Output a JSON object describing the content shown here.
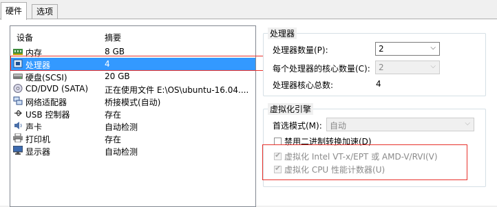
{
  "tabs": [
    {
      "label": "硬件",
      "active": true
    },
    {
      "label": "选项",
      "active": false
    }
  ],
  "device_list": {
    "headers": {
      "device": "设备",
      "summary": "摘要"
    },
    "rows": [
      {
        "icon": "memory-icon",
        "name": "内存",
        "value": "8 GB",
        "selected": false
      },
      {
        "icon": "processor-icon",
        "name": "处理器",
        "value": "4",
        "selected": true
      },
      {
        "icon": "hard-disk-icon",
        "name": "硬盘(SCSI)",
        "value": "20 GB",
        "selected": false
      },
      {
        "icon": "cd-dvd-icon",
        "name": "CD/DVD (SATA)",
        "value": "正在使用文件 E:\\OS\\ubuntu-16.04....",
        "selected": false
      },
      {
        "icon": "network-adapter-icon",
        "name": "网络适配器",
        "value": "桥接模式(自动)",
        "selected": false
      },
      {
        "icon": "usb-controller-icon",
        "name": "USB 控制器",
        "value": "存在",
        "selected": false
      },
      {
        "icon": "sound-card-icon",
        "name": "声卡",
        "value": "自动检测",
        "selected": false
      },
      {
        "icon": "printer-icon",
        "name": "打印机",
        "value": "存在",
        "selected": false
      },
      {
        "icon": "display-icon",
        "name": "显示器",
        "value": "自动检测",
        "selected": false
      }
    ]
  },
  "processor_group": {
    "title": "处理器",
    "count_label": "处理器数量(P):",
    "count_value": "2",
    "cores_label": "每个处理器的核心数量(C):",
    "cores_value": "2",
    "total_label": "处理器核心总数:",
    "total_value": "4"
  },
  "virt_group": {
    "title": "虚拟化引擎",
    "mode_label": "首选模式(M):",
    "mode_value": "自动",
    "disable_binary": {
      "label": "禁用二进制转换加速(D)",
      "checked": false
    },
    "vtx": {
      "label": "虚拟化 Intel VT-x/EPT 或 AMD-V/RVI(V)",
      "checked": true
    },
    "cpu_counters": {
      "label": "虚拟化 CPU 性能计数器(U)",
      "checked": true
    }
  },
  "colors": {
    "selection": "#3399ff",
    "highlight_box": "#e8302a"
  }
}
